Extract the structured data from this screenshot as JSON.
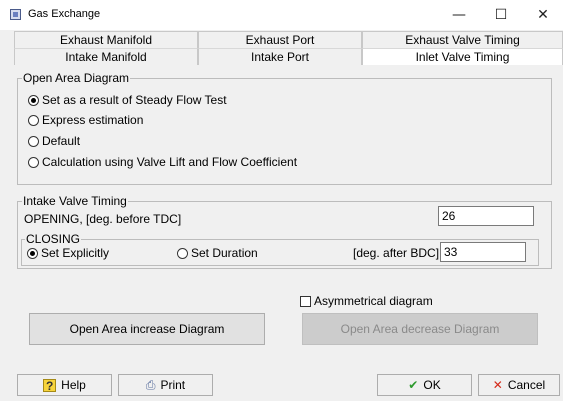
{
  "window": {
    "title": "Gas Exchange",
    "minimize": "—",
    "maximize": "☐",
    "close": "✕"
  },
  "tabs": {
    "back_row": [
      "Exhaust Manifold",
      "Exhaust Port",
      "Exhaust Valve Timing"
    ],
    "front_row": [
      "Intake Manifold",
      "Intake Port",
      "Inlet Valve Timing"
    ],
    "active": "Inlet Valve Timing"
  },
  "open_area": {
    "title": "Open Area Diagram",
    "options": [
      {
        "label": "Set as a result of Steady Flow Test",
        "selected": true
      },
      {
        "label": "Express estimation",
        "selected": false
      },
      {
        "label": "Default",
        "selected": false
      },
      {
        "label": "Calculation using Valve Lift and Flow Coefficient",
        "selected": false
      }
    ]
  },
  "timing": {
    "title": "Intake Valve Timing",
    "opening_label": "OPENING, [deg. before TDC]",
    "opening_value": "26",
    "closing": {
      "title": "CLOSING",
      "set_explicitly": "Set Explicitly",
      "set_duration": "Set Duration",
      "selected": "Set Explicitly",
      "unit_label": "[deg. after BDC]",
      "value": "33"
    }
  },
  "asymmetrical": {
    "label": "Asymmetrical diagram",
    "checked": false
  },
  "buttons": {
    "increase": "Open Area increase Diagram",
    "decrease": "Open Area decrease Diagram",
    "help": "Help",
    "print": "Print",
    "ok": "OK",
    "cancel": "Cancel"
  },
  "icons": {
    "help": "help-icon",
    "print": "printer-icon",
    "ok": "checkmark-icon",
    "cancel": "x-icon"
  }
}
